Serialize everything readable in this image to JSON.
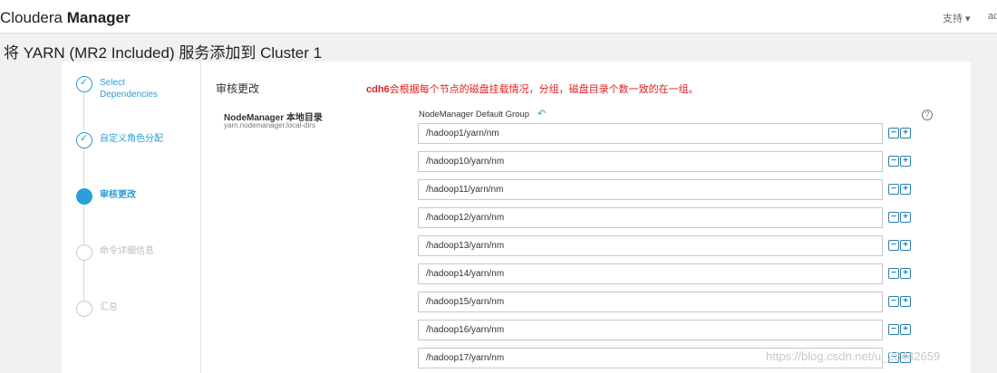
{
  "header": {
    "brand_light": "Cloudera ",
    "brand_bold": "Manager",
    "support": "支持 ▾",
    "user": "ac"
  },
  "page": {
    "title": "将 YARN (MR2 Included) 服务添加到 Cluster 1"
  },
  "steps": [
    {
      "label": "Select Dependencies",
      "state": "done"
    },
    {
      "label": "自定义角色分配",
      "state": "done"
    },
    {
      "label": "审核更改",
      "state": "active"
    },
    {
      "label": "命令详细信息",
      "state": "pending"
    },
    {
      "label": "汇总",
      "state": "pending"
    }
  ],
  "main": {
    "section_title": "审核更改",
    "annotation_bold": "cdh6",
    "annotation_rest": "会根据每个节点的磁盘挂载情况，分组，磁盘目录个数一致的在一组。",
    "property_label": "NodeManager 本地目录",
    "property_key": "yarn.nodemanager.local-dirs",
    "group_label": "NodeManager Default Group",
    "directories": [
      "/hadoop1/yarn/nm",
      "/hadoop10/yarn/nm",
      "/hadoop11/yarn/nm",
      "/hadoop12/yarn/nm",
      "/hadoop13/yarn/nm",
      "/hadoop14/yarn/nm",
      "/hadoop15/yarn/nm",
      "/hadoop16/yarn/nm",
      "/hadoop17/yarn/nm"
    ]
  },
  "watermark": "https://blog.csdn.net/u_28442659",
  "colors": {
    "accent": "#2a9fd8",
    "annotation": "#e02020"
  }
}
